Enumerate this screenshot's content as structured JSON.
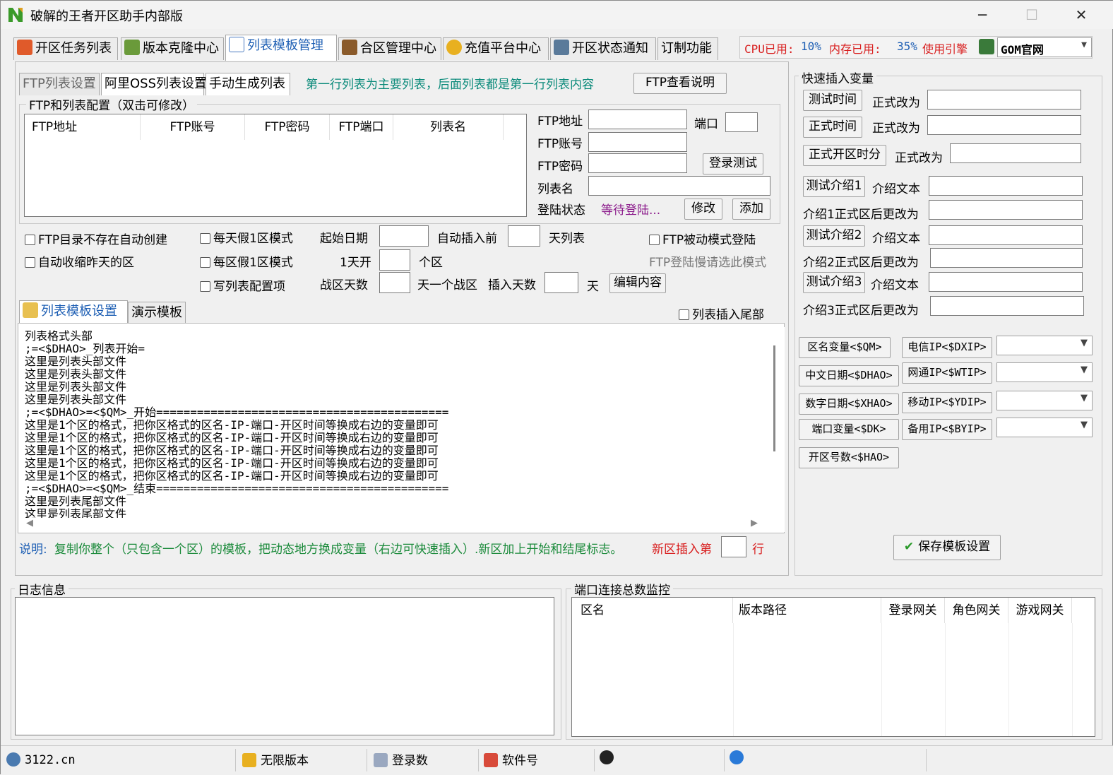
{
  "window": {
    "title": "破解的王者开区助手内部版",
    "minimize": "─",
    "maximize": "☐",
    "close": "✕"
  },
  "tabs": [
    "开区任务列表",
    "版本克隆中心",
    "列表模板管理",
    "合区管理中心",
    "充值平台中心",
    "开区状态通知",
    "订制功能"
  ],
  "sysinfo": {
    "cpu_label": "CPU已用:",
    "cpu_value": "10%",
    "mem_label": "内存已用:",
    "mem_value": "35%",
    "engine_label": "使用引擎",
    "engine_value": "GOM官网"
  },
  "subtabs": [
    "FTP列表设置",
    "阿里OSS列表设置",
    "手动生成列表"
  ],
  "subtab_note": "第一行列表为主要列表，后面列表都是第一行列表内容",
  "ftp_help_button": "FTP查看说明",
  "ftp_group_title": "FTP和列表配置（双击可修改）",
  "ftp_table_headers": [
    "FTP地址",
    "FTP账号",
    "FTP密码",
    "FTP端口",
    "列表名"
  ],
  "ftp_form": {
    "addr_label": "FTP地址",
    "port_label": "端口",
    "account_label": "FTP账号",
    "password_label": "FTP密码",
    "login_test": "登录测试",
    "list_name_label": "列表名",
    "status_label": "登陆状态",
    "status_value": "等待登陆...",
    "modify": "修改",
    "add": "添加"
  },
  "options": {
    "auto_create": "FTP目录不存在自动创建",
    "auto_shrink": "自动收缩昨天的区",
    "daily_fake": "每天假1区模式",
    "per_zone_fake": "每区假1区模式",
    "write_config": "写列表配置项",
    "start_date": "起始日期",
    "auto_insert_prefix": "自动插入前",
    "auto_insert_suffix": "天列表",
    "one_day_open": "1天开",
    "zone_unit": "个区",
    "war_days": "战区天数",
    "war_zone_suffix": "天一个战区",
    "insert_days": "插入天数",
    "day": "天",
    "edit_content": "编辑内容",
    "passive_mode": "FTP被动模式登陆",
    "passive_hint": "FTP登陆慢请选此模式"
  },
  "template_tabs": [
    "列表模板设置",
    "演示模板"
  ],
  "insert_tail": "列表插入尾部",
  "template_text": "列表格式头部\n;=<$DHAO>_列表开始=\n这里是列表头部文件\n这里是列表头部文件\n这里是列表头部文件\n这里是列表头部文件\n;=<$DHAO>=<$QM>_开始===========================================\n这里是1个区的格式，把你区格式的区名-IP-端口-开区时间等换成右边的变量即可\n这里是1个区的格式，把你区格式的区名-IP-端口-开区时间等换成右边的变量即可\n这里是1个区的格式，把你区格式的区名-IP-端口-开区时间等换成右边的变量即可\n这里是1个区的格式，把你区格式的区名-IP-端口-开区时间等换成右边的变量即可\n这里是1个区的格式，把你区格式的区名-IP-端口-开区时间等换成右边的变量即可\n;=<$DHAO>=<$QM>_结束===========================================\n这里是列表尾部文件\n这里是列表尾部文件",
  "note": {
    "label": "说明:",
    "text": "复制你整个（只包含一个区）的模板，把动态地方换成变量（右边可快速插入）.新区加上开始和结尾标志。",
    "insert_pos": "新区插入第",
    "row": "行"
  },
  "quick_insert": {
    "title": "快速插入变量",
    "rows": [
      {
        "button": "测试时间",
        "label": "正式改为"
      },
      {
        "button": "正式时间",
        "label": "正式改为"
      },
      {
        "button": "正式开区时分",
        "label": "正式改为"
      },
      {
        "button": "测试介绍1",
        "label": "介绍文本"
      },
      {
        "button": "",
        "label": "介绍1正式区后更改为"
      },
      {
        "button": "测试介绍2",
        "label": "介绍文本"
      },
      {
        "button": "",
        "label": "介绍2正式区后更改为"
      },
      {
        "button": "测试介绍3",
        "label": "介绍文本"
      },
      {
        "button": "",
        "label": "介绍3正式区后更改为"
      }
    ],
    "var_buttons_left": [
      "区名变量<$QM>",
      "中文日期<$DHAO>",
      "数字日期<$XHAO>",
      "端口变量<$DK>",
      "开区号数<$HAO>"
    ],
    "var_buttons_right": [
      "电信IP<$DXIP>",
      "网通IP<$WTIP>",
      "移动IP<$YDIP>",
      "备用IP<$BYIP>"
    ],
    "save": "保存模板设置"
  },
  "log_title": "日志信息",
  "monitor": {
    "title": "端口连接总数监控",
    "headers": [
      "区名",
      "版本路径",
      "登录网关",
      "角色网关",
      "游戏网关"
    ]
  },
  "statusbar": [
    "3122.cn",
    "无限版本",
    "登录数",
    "软件号"
  ],
  "colors": {
    "accent": "#1e5fb4",
    "note_green": "#1a8a3a",
    "red": "#d81e1e",
    "purple": "#8b1a8b",
    "teal": "#0a8a7a"
  }
}
